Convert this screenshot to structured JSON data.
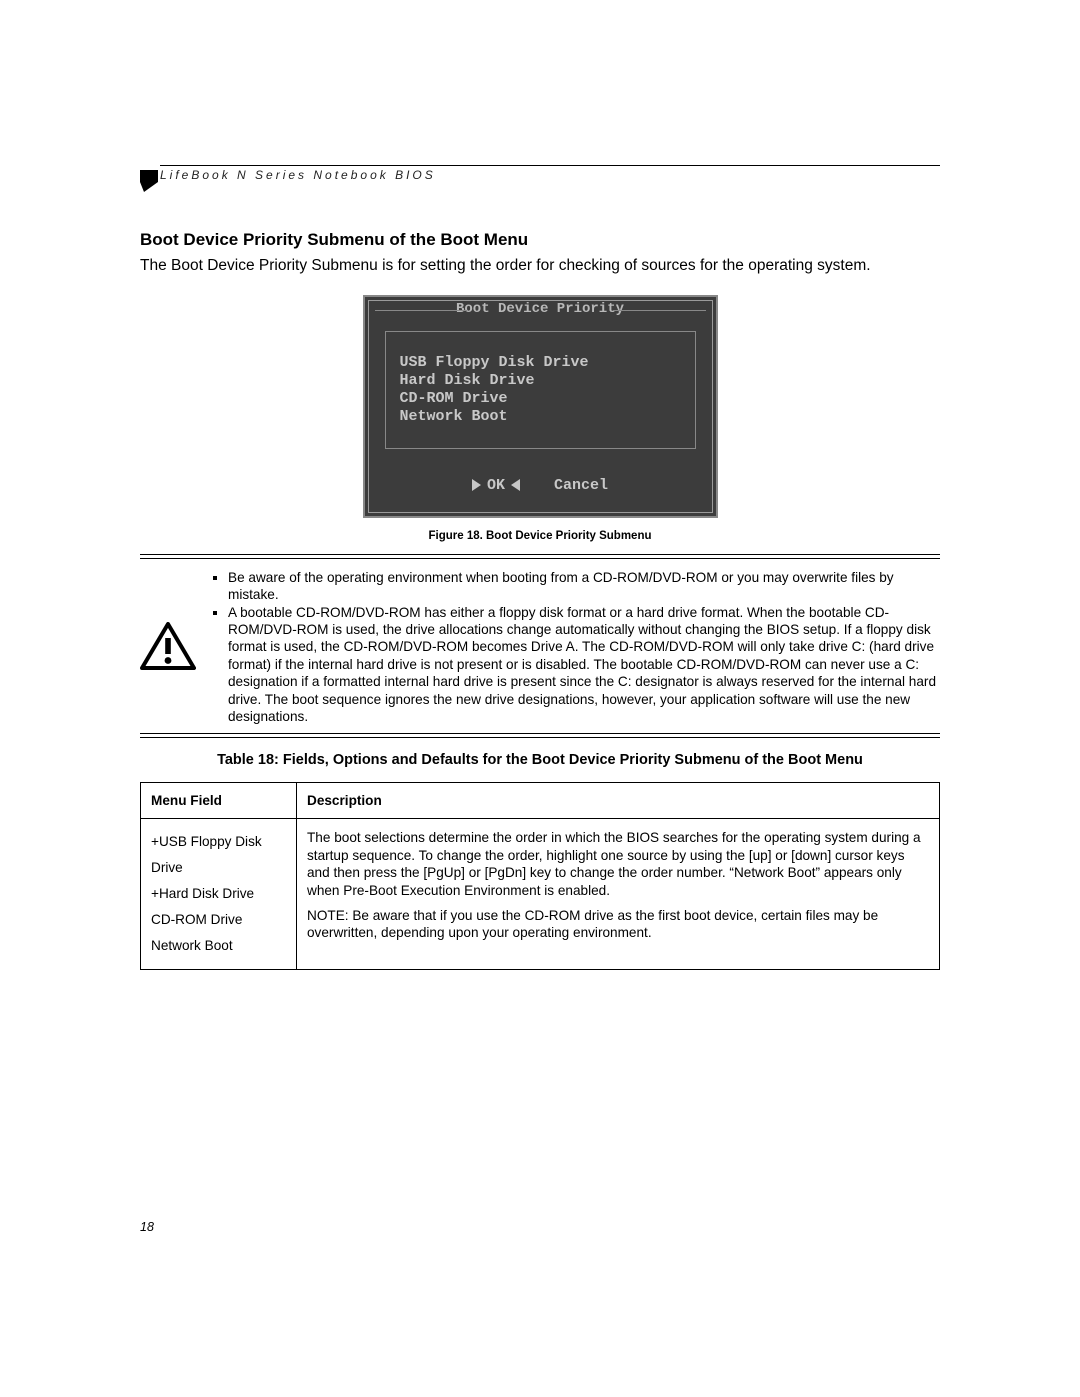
{
  "header": {
    "running_title": "LifeBook N Series Notebook BIOS"
  },
  "section": {
    "heading": "Boot Device Priority Submenu of the Boot Menu",
    "lead": "The Boot Device Priority Submenu is for setting the order for checking of sources for the operating system."
  },
  "bios": {
    "title": "Boot Device Priority",
    "items": [
      "USB Floppy Disk Drive",
      "Hard Disk Drive",
      "CD-ROM Drive",
      "Network Boot"
    ],
    "ok_label": "OK",
    "cancel_label": "Cancel"
  },
  "figure_caption": "Figure 18.  Boot Device Priority Submenu",
  "warning": {
    "bullet1": "Be aware of the operating environment when booting from a CD-ROM/DVD-ROM or you may overwrite files by mistake.",
    "bullet2": "A bootable CD-ROM/DVD-ROM has either a floppy disk format or a hard drive format. When the bootable CD-ROM/DVD-ROM is used, the drive allocations change automatically without changing the BIOS setup. If a floppy disk format is used, the CD-ROM/DVD-ROM becomes Drive A. The CD-ROM/DVD-ROM will only take drive C: (hard drive format) if the internal hard drive is not present or is disabled. The bootable CD-ROM/DVD-ROM can never use a C: designation if a formatted internal hard drive is present since the C: designator is always reserved for the internal hard drive. The boot sequence ignores the new drive designations, however, your application software will use the new designations."
  },
  "table": {
    "title": "Table 18: Fields, Options and Defaults for the Boot Device Priority Submenu of the Boot Menu",
    "col1": "Menu Field",
    "col2": "Description",
    "menu_items": [
      "+USB Floppy Disk Drive",
      "+Hard Disk Drive",
      " CD-ROM Drive",
      " Network Boot"
    ],
    "desc_p1": "The boot selections determine the order in which the BIOS searches for the operating system during a startup sequence. To change the order, highlight one source by using the [up] or [down] cursor keys and then press the [PgUp] or [PgDn] key to change the order number. “Network Boot” appears only when Pre-Boot Execution Environment is enabled.",
    "desc_p2": "NOTE: Be aware that if you use the CD-ROM drive as the first boot device, certain files may be overwritten, depending upon your operating environment."
  },
  "page_number": "18"
}
